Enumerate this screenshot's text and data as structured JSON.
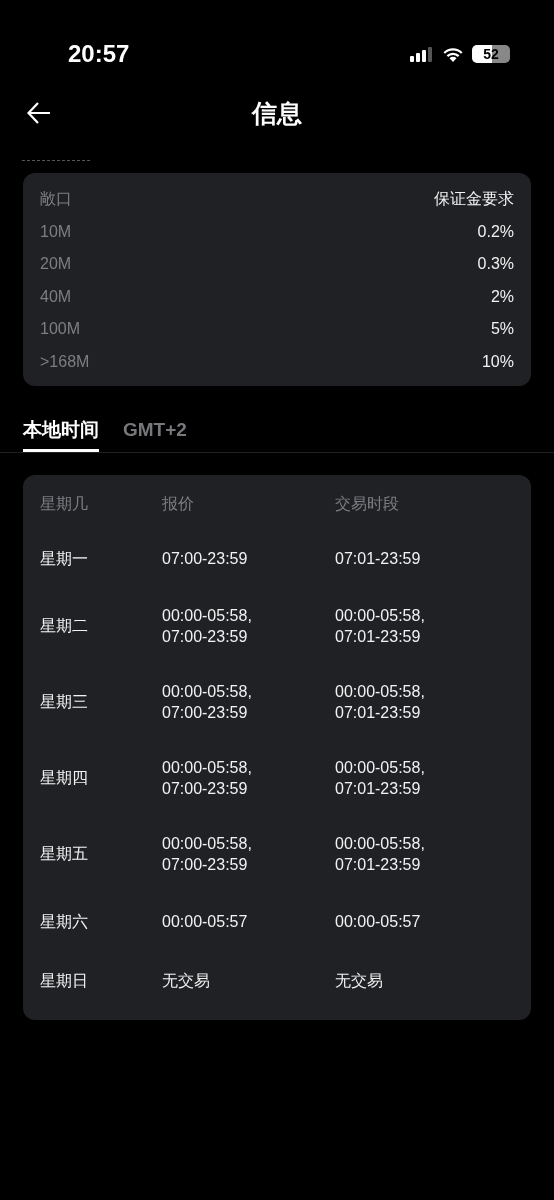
{
  "status_bar": {
    "time": "20:57",
    "battery": "52"
  },
  "header": {
    "title": "信息"
  },
  "margin_table": {
    "columns": [
      "敞口",
      "保证金要求"
    ],
    "rows": [
      [
        "10M",
        "0.2%"
      ],
      [
        "20M",
        "0.3%"
      ],
      [
        "40M",
        "2%"
      ],
      [
        "100M",
        "5%"
      ],
      [
        ">168M",
        "10%"
      ]
    ]
  },
  "tabs": [
    {
      "label": "本地时间",
      "selected": true
    },
    {
      "label": "GMT+2",
      "selected": false
    }
  ],
  "schedule_table": {
    "columns": [
      "星期几",
      "报价",
      "交易时段"
    ],
    "rows": [
      {
        "day": "星期一",
        "quote": [
          "07:00-23:59"
        ],
        "session": [
          "07:01-23:59"
        ]
      },
      {
        "day": "星期二",
        "quote": [
          "00:00-05:58,",
          "07:00-23:59"
        ],
        "session": [
          "00:00-05:58,",
          "07:01-23:59"
        ]
      },
      {
        "day": "星期三",
        "quote": [
          "00:00-05:58,",
          "07:00-23:59"
        ],
        "session": [
          "00:00-05:58,",
          "07:01-23:59"
        ]
      },
      {
        "day": "星期四",
        "quote": [
          "00:00-05:58,",
          "07:00-23:59"
        ],
        "session": [
          "00:00-05:58,",
          "07:01-23:59"
        ]
      },
      {
        "day": "星期五",
        "quote": [
          "00:00-05:58,",
          "07:00-23:59"
        ],
        "session": [
          "00:00-05:58,",
          "07:01-23:59"
        ]
      },
      {
        "day": "星期六",
        "quote": [
          "00:00-05:57"
        ],
        "session": [
          "00:00-05:57"
        ]
      },
      {
        "day": "星期日",
        "quote": [
          "无交易"
        ],
        "session": [
          "无交易"
        ]
      }
    ]
  }
}
